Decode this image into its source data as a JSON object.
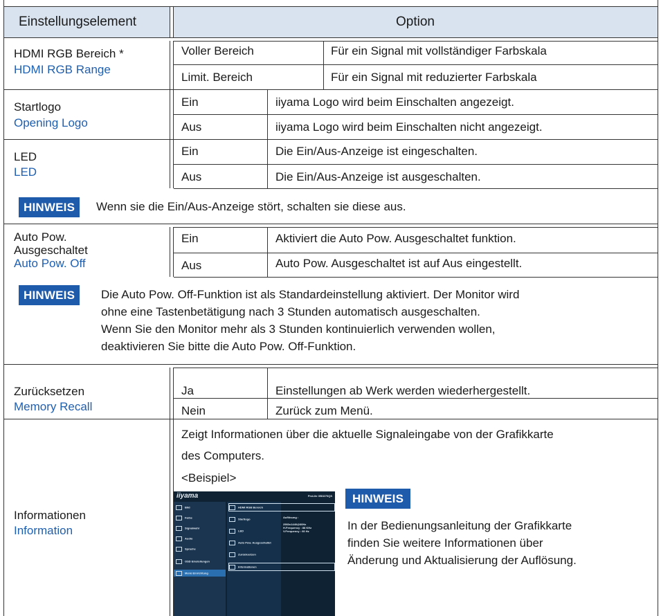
{
  "header": {
    "col1": "Einstellungselement",
    "col2": "Option"
  },
  "hdmi": {
    "label_de": "HDMI RGB Bereich *",
    "label_en": "HDMI RGB Range",
    "opt1": "Voller Bereich",
    "desc1": "Für ein Signal mit vollständiger Farbskala",
    "opt2": "Limit. Bereich",
    "desc2": "Für ein Signal mit reduzierter Farbskala"
  },
  "startlogo": {
    "label_de": "Startlogo",
    "label_en": "Opening Logo",
    "opt1": "Ein",
    "desc1": "iiyama Logo wird beim Einschalten angezeigt.",
    "opt2": "Aus",
    "desc2": "iiyama Logo wird beim Einschalten nicht angezeigt."
  },
  "led": {
    "label_de": "LED",
    "label_en": "LED",
    "opt1": "Ein",
    "desc1": "Die Ein/Aus-Anzeige ist eingeschalten.",
    "opt2": "Aus",
    "desc2": "Die Ein/Aus-Anzeige ist ausgeschalten."
  },
  "note1": {
    "badge": "HINWEIS",
    "text": "Wenn sie die Ein/Aus-Anzeige stört, schalten sie diese aus."
  },
  "autopow": {
    "label_de_1": "Auto Pow.",
    "label_de_2": "Ausgeschaltet",
    "label_en": "Auto Pow. Off",
    "opt1": "Ein",
    "desc1": "Aktiviert die Auto Pow. Ausgeschaltet funktion.",
    "opt2": "Aus",
    "desc2": "Auto Pow. Ausgeschaltet ist auf Aus eingestellt."
  },
  "note2": {
    "badge": "HINWEIS",
    "line1": "Die Auto Pow. Off-Funktion ist als Standardeinstellung aktiviert. Der Monitor wird",
    "line2": "ohne eine Tastenbetätigung nach 3 Stunden automatisch ausgeschalten.",
    "line3": "Wenn Sie den Monitor mehr als 3 Stunden kontinuierlich verwenden wollen,",
    "line4": "deaktivieren Sie bitte die Auto Pow. Off-Funktion."
  },
  "reset": {
    "label_de": "Zurücksetzen",
    "label_en": "Memory Recall",
    "opt1": "Ja",
    "desc1": "Einstellungen ab Werk werden wiederhergestellt.",
    "opt2": "Nein",
    "desc2": "Zurück zum Menü."
  },
  "info": {
    "label_de": "Informationen",
    "label_en": "Information",
    "desc_line1": "Zeigt Informationen über die aktuelle Signaleingabe von der Grafikkarte",
    "desc_line2": "des Computers.",
    "example": "<Beispiel>",
    "note_badge": "HINWEIS",
    "note_line1": "In der Bedienungsanleitung der Grafikkarte",
    "note_line2": "finden Sie weitere Informationen über",
    "note_line3": "Änderung und Aktualisierung der Auflösung."
  },
  "osd": {
    "logo": "iiyama",
    "model": "ProLite XB3270QS",
    "menu": [
      "Bild",
      "Farbe",
      "Signalwahl",
      "Audio",
      "Sprache",
      "OSD Einstellungen",
      "Menü Einrichtung"
    ],
    "items": [
      "HDMI RGB Bereich",
      "Startlogo",
      "LED",
      "Auto Pow. Ausgeschaltet",
      "Zurücksetzen",
      "Informationen"
    ],
    "info_title": "Auflösung :",
    "info_res": "2560x1440@60Hz",
    "info_h": "H.Frequency : 88 KHz",
    "info_v": "V.Frequency : 60 Hz"
  }
}
